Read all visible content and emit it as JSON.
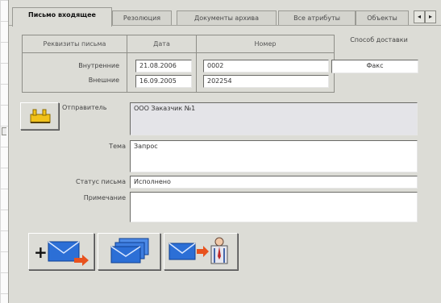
{
  "tabs": [
    {
      "label": "Письмо входящее",
      "active": true
    },
    {
      "label": "Резолюция",
      "active": false
    },
    {
      "label": "Документы архива",
      "active": false
    },
    {
      "label": "Все атрибуты",
      "active": false
    },
    {
      "label": "Объекты",
      "active": false
    }
  ],
  "tab_scroll": {
    "left": "◂",
    "right": "▸"
  },
  "requisites": {
    "header_label": "Реквизиты письма",
    "header_date": "Дата",
    "header_number": "Номер",
    "rows": [
      {
        "label": "Внутренние",
        "date": "21.08.2006",
        "number": "0002"
      },
      {
        "label": "Внешние",
        "date": "16.09.2005",
        "number": "202254"
      }
    ]
  },
  "delivery": {
    "label": "Способ доставки",
    "value": "Факс"
  },
  "form": {
    "sender_label": "Отправитель",
    "sender_value": "ООО Заказчик №1",
    "subject_label": "Тема",
    "subject_value": "Запрос",
    "status_label": "Статус письма",
    "status_value": "Исполнено",
    "note_label": "Примечание",
    "note_value": ""
  },
  "icons": {
    "sender_button": "organization-icon",
    "new_letter": "add-letter-icon",
    "letters_stack": "letter-stack-icon",
    "send_to_person": "send-letter-to-person-icon"
  },
  "colors": {
    "window_bg": "#dcdcd6",
    "envelope_blue": "#2c6fd6",
    "arrow_orange": "#e8521e",
    "sender_icon": "#f1c21b"
  }
}
